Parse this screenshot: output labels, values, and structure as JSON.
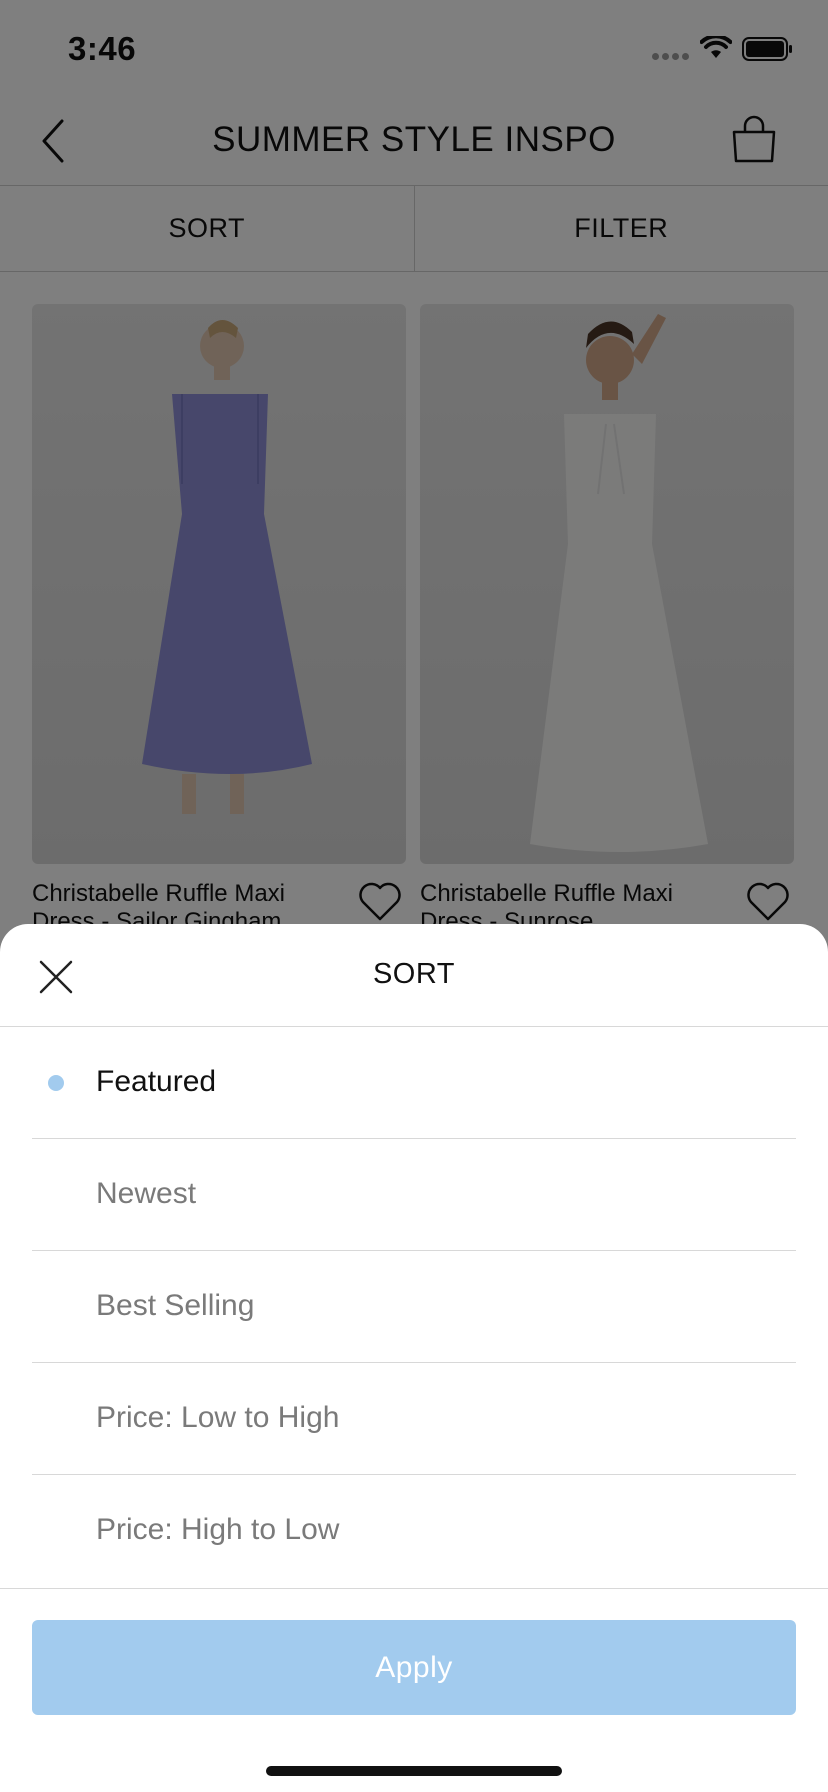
{
  "status_bar": {
    "time": "3:46"
  },
  "nav": {
    "title": "SUMMER STYLE INSPO"
  },
  "toolbar": {
    "sort_label": "SORT",
    "filter_label": "FILTER"
  },
  "products": [
    {
      "name": "Christabelle Ruffle Maxi Dress - Sailor Gingham",
      "dress_color": "#8e8fd6"
    },
    {
      "name": "Christabelle Ruffle Maxi Dress - Sunrose",
      "dress_color": "#f7f7f5"
    }
  ],
  "sort_sheet": {
    "title": "SORT",
    "options": [
      {
        "label": "Featured",
        "selected": true
      },
      {
        "label": "Newest",
        "selected": false
      },
      {
        "label": "Best Selling",
        "selected": false
      },
      {
        "label": "Price: Low to High",
        "selected": false
      },
      {
        "label": "Price: High to Low",
        "selected": false
      }
    ],
    "apply_label": "Apply"
  },
  "colors": {
    "accent": "#a2cbee",
    "overlay": "rgba(0,0,0,0.5)",
    "text": "#111111",
    "muted_text": "#7a7a7a"
  }
}
